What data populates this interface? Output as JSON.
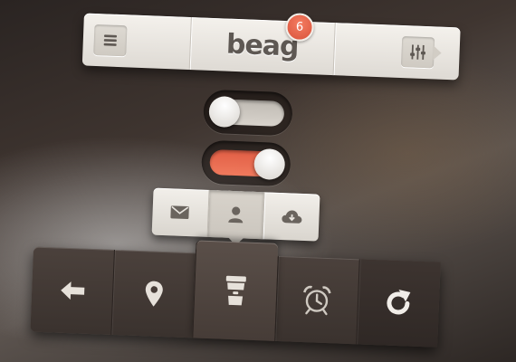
{
  "app": {
    "logo_text": "beag",
    "notification_count": "6"
  },
  "top_bar": {
    "icons": {
      "left": "menu-icon",
      "right": "sliders-icon"
    }
  },
  "toggles": [
    {
      "name": "toggle-one",
      "state": "off"
    },
    {
      "name": "toggle-two",
      "state": "on"
    }
  ],
  "segmented_actions": {
    "items": [
      {
        "icon": "envelope-icon",
        "active": false
      },
      {
        "icon": "user-icon",
        "active": true
      },
      {
        "icon": "cloud-download-icon",
        "active": false
      }
    ]
  },
  "bottom_toolbar": {
    "items": [
      {
        "icon": "back-arrow-icon",
        "active": false
      },
      {
        "icon": "location-pin-icon",
        "active": false
      },
      {
        "icon": "coffee-cup-icon",
        "active": true
      },
      {
        "icon": "alarm-clock-icon",
        "active": false
      },
      {
        "icon": "refresh-icon",
        "active": false
      }
    ]
  },
  "colors": {
    "accent": "#e8654a",
    "light_surface": "#ece8e2",
    "dark_surface": "#423935",
    "icon_dark": "#5e5853",
    "icon_light": "#e6e1da"
  }
}
